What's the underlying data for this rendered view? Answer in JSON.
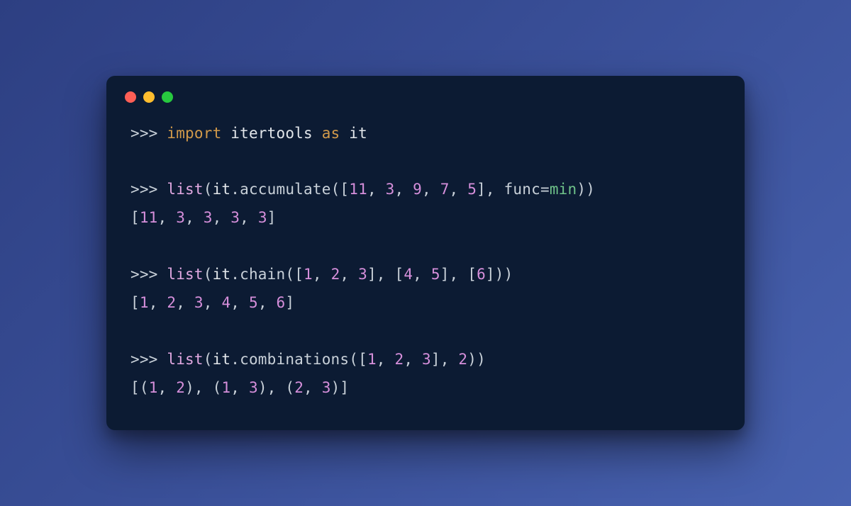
{
  "window": {
    "traffic_lights": [
      "close",
      "minimize",
      "zoom"
    ]
  },
  "code": {
    "prompt": ">>> ",
    "kw_import": "import",
    "kw_as": "as",
    "id_itertools": "itertools",
    "id_it": "it",
    "fn_list": "list",
    "dot": ".",
    "m_accumulate": "accumulate",
    "m_chain": "chain",
    "m_combinations": "combinations",
    "lp": "(",
    "rp": ")",
    "lb": "[",
    "rb": "]",
    "comma": ", ",
    "kw_func": "func",
    "eq": "=",
    "builtin_min": "min",
    "n11": "11",
    "n3": "3",
    "n9": "9",
    "n7": "7",
    "n5": "5",
    "n1": "1",
    "n2": "2",
    "n4": "4",
    "n6": "6",
    "out_accumulate": "[11, 3, 3, 3, 3]",
    "out_chain": "[1, 2, 3, 4, 5, 6]",
    "out_comb_open": "[(",
    "out_comb_mid": "), (",
    "out_comb_close": ")]",
    "o1": "1",
    "o2": "2",
    "o3": "3",
    "o4": "4",
    "o5": "5",
    "o6": "6",
    "o11": "11"
  }
}
